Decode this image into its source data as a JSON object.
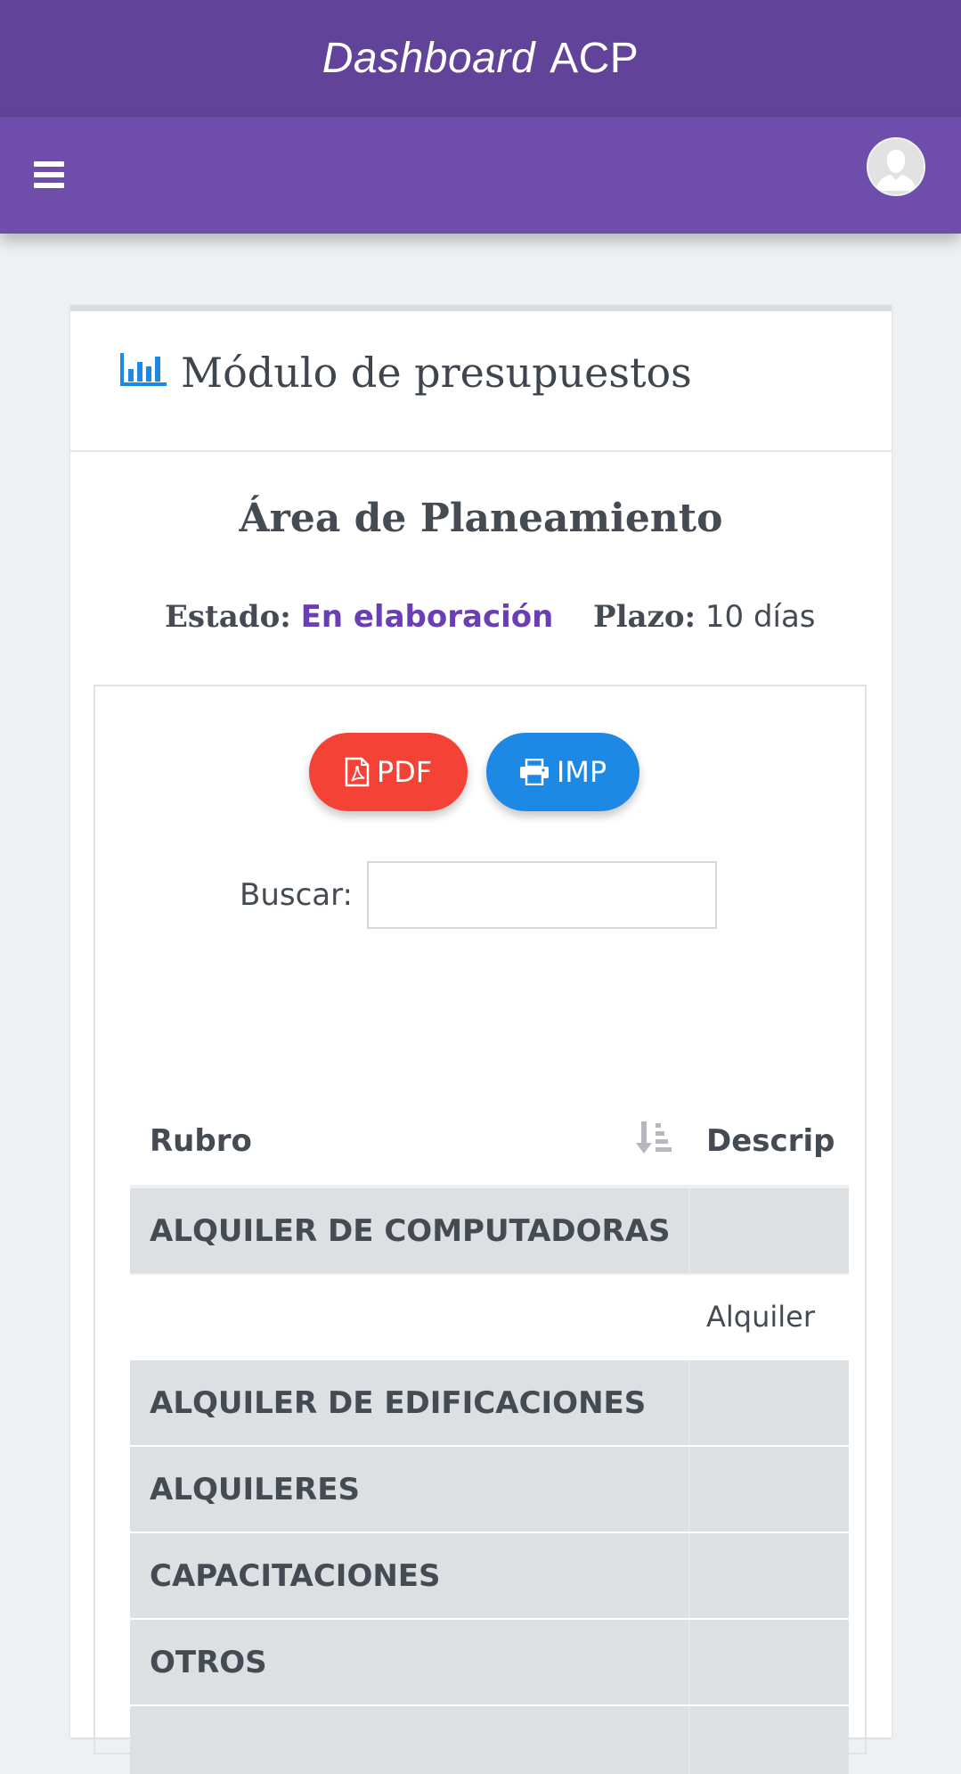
{
  "header": {
    "title_italic": "Dashboard",
    "title_rest": "ACP"
  },
  "navbar": {
    "menu_icon": "bars-icon",
    "avatar_icon": "user-avatar-icon"
  },
  "card": {
    "title": "Módulo de presupuestos",
    "title_icon": "bar-chart-icon",
    "area_title": "Área de Planeamiento",
    "estado_label": "Estado:",
    "estado_value": "En elaboración",
    "plazo_label": "Plazo:",
    "plazo_value": "10 días"
  },
  "actions": {
    "pdf_label": "PDF",
    "pdf_icon": "file-pdf-icon",
    "imp_label": "IMP",
    "imp_icon": "print-icon"
  },
  "search": {
    "label": "Buscar:",
    "value": "",
    "placeholder": ""
  },
  "table": {
    "columns": [
      "Rubro",
      "Descrip"
    ],
    "sort_icon": "sort-amount-down-icon",
    "rows": [
      {
        "rubro": "ALQUILER DE COMPUTADORAS",
        "descripcion": ""
      },
      {
        "rubro": "",
        "descripcion": "Alquiler"
      },
      {
        "rubro": "ALQUILER DE EDIFICACIONES",
        "descripcion": ""
      },
      {
        "rubro": "ALQUILERES",
        "descripcion": ""
      },
      {
        "rubro": "CAPACITACIONES",
        "descripcion": ""
      },
      {
        "rubro": "OTROS",
        "descripcion": ""
      }
    ]
  },
  "colors": {
    "topbar": "#62439a",
    "navbar": "#6e4dab",
    "estado": "#6a3fb5",
    "pdf_button": "#f44336",
    "imp_button": "#1e88e5",
    "chart_icon": "#1e88e5"
  }
}
